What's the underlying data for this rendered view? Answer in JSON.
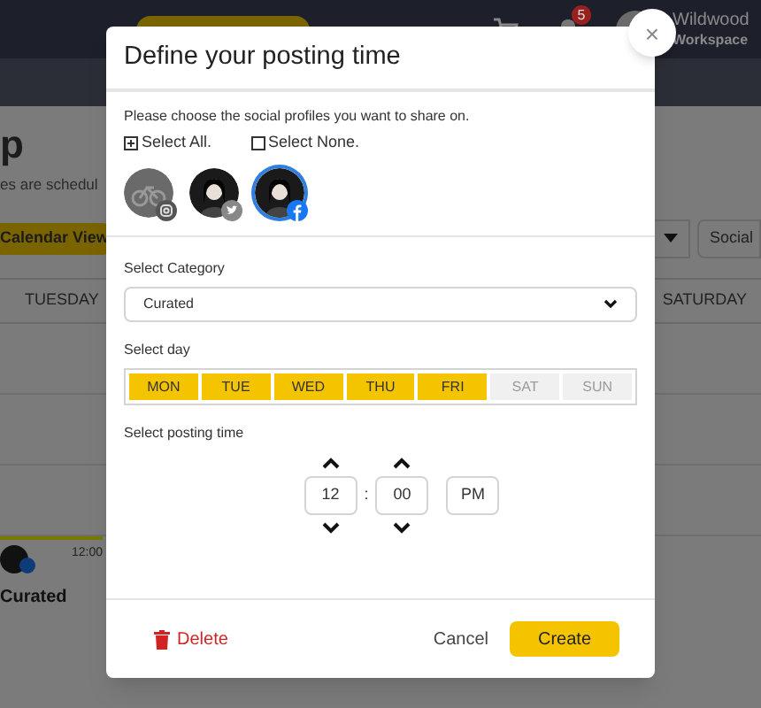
{
  "app": {
    "notifications": "5",
    "workspace_name": "Wildwood",
    "workspace_label": "Workspace",
    "page_title": "p",
    "page_subtitle": "es are schedul",
    "calendar_view": "Calendar View",
    "social_button": "Social",
    "columns": [
      "TUESDAY",
      "SATURDAY"
    ],
    "event": {
      "time": "12:00",
      "category": "Curated"
    }
  },
  "dialog": {
    "title": "Define your posting time",
    "instruction": "Please choose the social profiles you want to share on.",
    "select_all": "Select All.",
    "select_none": "Select None.",
    "profiles": [
      {
        "kind": "instagram",
        "selected": false,
        "disabled": true
      },
      {
        "kind": "twitter",
        "selected": false,
        "disabled": false
      },
      {
        "kind": "facebook",
        "selected": true,
        "disabled": false
      }
    ],
    "category_label": "Select Category",
    "category": "Curated",
    "day_label": "Select day",
    "days": [
      {
        "label": "MON",
        "selected": true
      },
      {
        "label": "TUE",
        "selected": true
      },
      {
        "label": "WED",
        "selected": true
      },
      {
        "label": "THU",
        "selected": true
      },
      {
        "label": "FRI",
        "selected": true
      },
      {
        "label": "SAT",
        "selected": false
      },
      {
        "label": "SUN",
        "selected": false
      }
    ],
    "time_label": "Select posting time",
    "hour": "12",
    "minute": "00",
    "separator": ":",
    "period": "PM",
    "delete": "Delete",
    "cancel": "Cancel",
    "create": "Create",
    "close": "×"
  }
}
